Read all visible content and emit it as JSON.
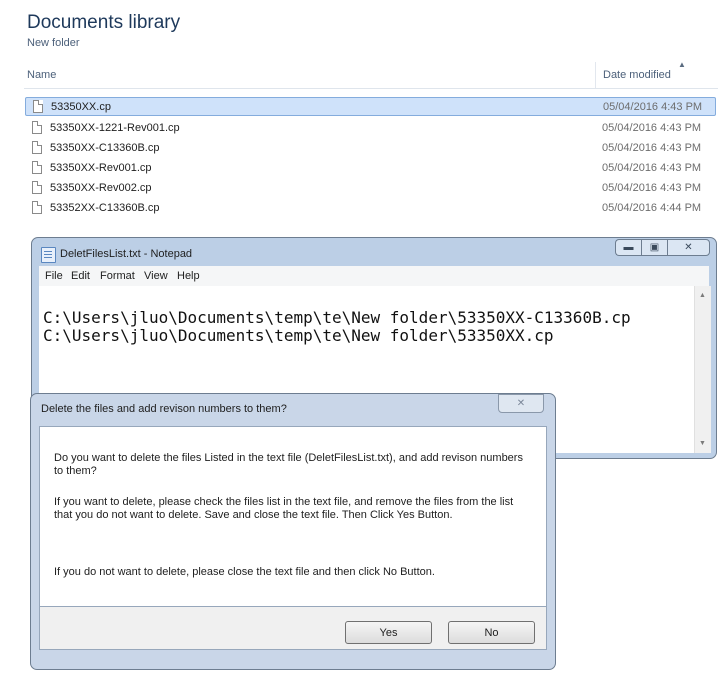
{
  "library": {
    "title": "Documents library",
    "subtitle": "New folder",
    "columns": {
      "name": "Name",
      "date": "Date modified"
    },
    "files": [
      {
        "name": "53350XX.cp",
        "date": "05/04/2016 4:43 PM",
        "selected": true
      },
      {
        "name": "53350XX-1221-Rev001.cp",
        "date": "05/04/2016 4:43 PM",
        "selected": false
      },
      {
        "name": "53350XX-C13360B.cp",
        "date": "05/04/2016 4:43 PM",
        "selected": false
      },
      {
        "name": "53350XX-Rev001.cp",
        "date": "05/04/2016 4:43 PM",
        "selected": false
      },
      {
        "name": "53350XX-Rev002.cp",
        "date": "05/04/2016 4:43 PM",
        "selected": false
      },
      {
        "name": "53352XX-C13360B.cp",
        "date": "05/04/2016 4:44 PM",
        "selected": false
      }
    ]
  },
  "notepad": {
    "title": "DeletFilesList.txt - Notepad",
    "menu": [
      "File",
      "Edit",
      "Format",
      "View",
      "Help"
    ],
    "lines": [
      "C:\\Users\\jluo\\Documents\\temp\\te\\New folder\\53350XX-C13360B.cp",
      "C:\\Users\\jluo\\Documents\\temp\\te\\New folder\\53350XX.cp"
    ]
  },
  "dialog": {
    "title": "Delete the files and add revison numbers to them?",
    "paragraphs": [
      "Do you want to delete the files Listed in the text file (DeletFilesList.txt), and add revison numbers to them?",
      "If you want to delete, please check the files list in the text file, and remove the files from the list that you do not want to delete. Save and close the text file. Then Click Yes Button.",
      "If you  do not want to delete, please close the text file and then click No Button."
    ],
    "yes_label": "Yes",
    "no_label": "No"
  }
}
